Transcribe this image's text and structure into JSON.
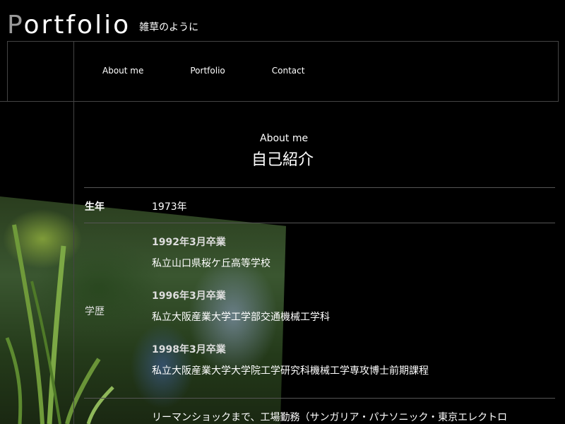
{
  "header": {
    "logo_first": "P",
    "logo_rest": "ortfolio",
    "tagline": "雑草のように"
  },
  "nav": {
    "items": [
      {
        "label": "About me"
      },
      {
        "label": "Portfolio"
      },
      {
        "label": "Contact"
      }
    ]
  },
  "about": {
    "title_en": "About me",
    "title_ja": "自己紹介",
    "birth_label": "生年",
    "birth_value": "1973年",
    "education_label": "学歴",
    "education": [
      {
        "date": "1992年3月卒業",
        "school": "私立山口県桜ケ丘高等学校"
      },
      {
        "date": "1996年3月卒業",
        "school": "私立大阪産業大学工学部交通機械工学科"
      },
      {
        "date": "1998年3月卒業",
        "school": "私立大阪産業大学大学院工学研究科機械工学専攻博士前期課程"
      }
    ],
    "career_text": "リーマンショックまで、工場勤務（サンガリア・パナソニック・東京エレクトロ"
  },
  "colors": {
    "background": "#000000",
    "text": "#ffffff",
    "logo_initial": "#9a9a9a",
    "lines": "#444444"
  }
}
